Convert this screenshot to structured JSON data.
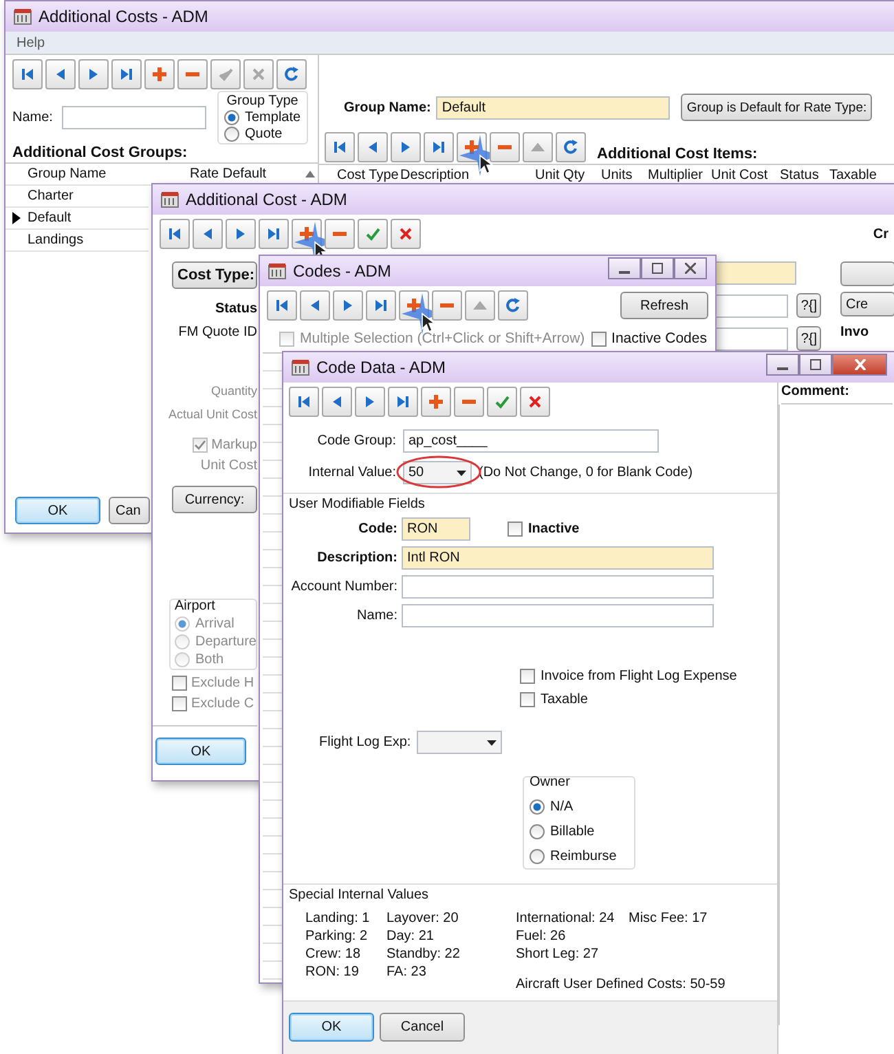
{
  "costs_window": {
    "title": "Additional Costs - ADM",
    "menu": [
      "Help"
    ],
    "toolbar": [
      {
        "kind": "first",
        "disabled": false,
        "clicked": false
      },
      {
        "kind": "prev",
        "disabled": false,
        "clicked": false
      },
      {
        "kind": "next",
        "disabled": false,
        "clicked": false
      },
      {
        "kind": "last",
        "disabled": false,
        "clicked": false
      },
      {
        "kind": "add",
        "disabled": false,
        "clicked": false
      },
      {
        "kind": "remove",
        "disabled": false,
        "clicked": false
      },
      {
        "kind": "save",
        "disabled": true,
        "clicked": false
      },
      {
        "kind": "cancel",
        "disabled": true,
        "clicked": false
      },
      {
        "kind": "refresh",
        "disabled": false,
        "clicked": false
      }
    ],
    "name_label": "Name:",
    "group_type": {
      "label": "Group Type",
      "options": [
        {
          "label": "Template",
          "selected": true
        },
        {
          "label": "Quote",
          "selected": false
        }
      ]
    },
    "groups_title": "Additional Cost Groups:",
    "groups_table": {
      "columns": [
        "Group Name",
        "Rate Default"
      ],
      "rows": [
        {
          "name": "Charter",
          "selected": false
        },
        {
          "name": "Default",
          "selected": true
        },
        {
          "name": "Landings",
          "selected": false
        }
      ]
    },
    "group_name_label": "Group Name:",
    "group_name_value": "Default",
    "rate_type_button": "Group is Default for Rate Type:",
    "items_toolbar": [
      {
        "kind": "first",
        "disabled": false,
        "clicked": false
      },
      {
        "kind": "prev",
        "disabled": false,
        "clicked": false
      },
      {
        "kind": "next",
        "disabled": false,
        "clicked": false
      },
      {
        "kind": "last",
        "disabled": false,
        "clicked": false
      },
      {
        "kind": "add",
        "disabled": false,
        "clicked": true
      },
      {
        "kind": "remove",
        "disabled": false,
        "clicked": false
      },
      {
        "kind": "up",
        "disabled": true,
        "clicked": false
      },
      {
        "kind": "refresh",
        "disabled": false,
        "clicked": false
      }
    ],
    "items_title": "Additional Cost Items:",
    "items_table": {
      "columns": [
        "Cost Type",
        "Description",
        "Unit Qty",
        "Units",
        "Multiplier",
        "Unit Cost",
        "Status",
        "Taxable"
      ]
    },
    "buttons": [
      {
        "label": "OK",
        "default": true
      },
      {
        "label": "Can",
        "default": false
      }
    ]
  },
  "cost_window": {
    "title": "Additional Cost - ADM",
    "toolbar": [
      {
        "kind": "first",
        "disabled": false,
        "clicked": false
      },
      {
        "kind": "prev",
        "disabled": false,
        "clicked": false
      },
      {
        "kind": "next",
        "disabled": false,
        "clicked": false
      },
      {
        "kind": "last",
        "disabled": false,
        "clicked": false
      },
      {
        "kind": "add",
        "disabled": false,
        "clicked": true
      },
      {
        "kind": "remove",
        "disabled": false,
        "clicked": false
      },
      {
        "kind": "save",
        "disabled": false,
        "clicked": false
      },
      {
        "kind": "cancel",
        "disabled": false,
        "clicked": false
      }
    ],
    "corner_label": "Cr",
    "cost_type_button": "Cost Type:",
    "labels_top": [
      {
        "text": "Status",
        "disabled": false
      },
      {
        "text": "FM Quote ID",
        "disabled": false
      }
    ],
    "labels_mid": [
      {
        "text": "Quantity",
        "disabled": true
      },
      {
        "text": "Actual Unit Cost",
        "disabled": true
      }
    ],
    "markup": {
      "label": "Markup",
      "checked": true,
      "disabled": true
    },
    "unit_cost_label": {
      "text": "Unit Cost",
      "disabled": true
    },
    "currency_button": "Currency:",
    "airport": {
      "label": "Airport",
      "disabled": true,
      "options": [
        {
          "label": "Arrival",
          "selected": true
        },
        {
          "label": "Departure",
          "selected": false
        },
        {
          "label": "Both",
          "selected": false
        }
      ]
    },
    "excludes": [
      {
        "label": "Exclude H",
        "checked": false
      },
      {
        "label": "Exclude C",
        "checked": false
      }
    ],
    "ok_button": "OK",
    "lookup_buttons": [
      "?{]",
      "?{]"
    ],
    "side_button": "Cre",
    "side_label": "Invo"
  },
  "codes_window": {
    "title": "Codes - ADM",
    "toolbar": [
      {
        "kind": "first",
        "disabled": false,
        "clicked": false
      },
      {
        "kind": "prev",
        "disabled": false,
        "clicked": false
      },
      {
        "kind": "next",
        "disabled": false,
        "clicked": false
      },
      {
        "kind": "last",
        "disabled": false,
        "clicked": false
      },
      {
        "kind": "add",
        "disabled": false,
        "clicked": true
      },
      {
        "kind": "remove",
        "disabled": false,
        "clicked": false
      },
      {
        "kind": "up",
        "disabled": true,
        "clicked": false
      },
      {
        "kind": "refresh",
        "disabled": false,
        "clicked": false
      }
    ],
    "refresh_button": "Refresh",
    "multi_select": {
      "label": "Multiple Selection (Ctrl+Click or Shift+Arrow)",
      "checked": false,
      "disabled": true
    },
    "inactive_codes": {
      "label": "Inactive Codes",
      "checked": false
    }
  },
  "code_data_window": {
    "title": "Code Data - ADM",
    "toolbar": [
      {
        "kind": "first",
        "disabled": false,
        "clicked": false
      },
      {
        "kind": "prev",
        "disabled": false,
        "clicked": false
      },
      {
        "kind": "next",
        "disabled": false,
        "clicked": false
      },
      {
        "kind": "last",
        "disabled": false,
        "clicked": false
      },
      {
        "kind": "add",
        "disabled": false,
        "clicked": false
      },
      {
        "kind": "remove",
        "disabled": false,
        "clicked": false
      },
      {
        "kind": "save",
        "disabled": false,
        "clicked": false
      },
      {
        "kind": "cancel",
        "disabled": false,
        "clicked": false
      }
    ],
    "code_group": {
      "label": "Code Group:",
      "value": "ap_cost____"
    },
    "internal_value": {
      "label": "Internal Value:",
      "value": "50",
      "annotated": true
    },
    "internal_hint": "(Do Not Change, 0 for Blank Code)",
    "fields_group": "User Modifiable Fields",
    "code": {
      "label": "Code:",
      "value": "RON"
    },
    "inactive": {
      "label": "Inactive",
      "checked": false
    },
    "description": {
      "label": "Description:",
      "value": "Intl RON"
    },
    "account_label": "Account Number:",
    "name_label": "Name:",
    "checks": [
      {
        "label": "Invoice from Flight Log Expense",
        "checked": false
      },
      {
        "label": "Taxable",
        "checked": false
      }
    ],
    "flight_log_label": "Flight Log Exp:",
    "owner": {
      "label": "Owner",
      "options": [
        {
          "label": "N/A",
          "selected": true
        },
        {
          "label": "Billable",
          "selected": false
        },
        {
          "label": "Reimburse",
          "selected": false
        }
      ]
    },
    "special": {
      "title": "Special Internal Values",
      "columns": [
        [
          "Landing: 1",
          "Parking: 2",
          "Crew: 18",
          "RON: 19"
        ],
        [
          "Layover: 20",
          "Day: 21",
          "Standby: 22",
          "FA: 23"
        ],
        [
          "International: 24",
          "Fuel: 26",
          "Short Leg: 27"
        ],
        [
          "Misc Fee: 17"
        ]
      ],
      "footer": "Aircraft User Defined Costs: 50-59"
    },
    "comment_label": "Comment:",
    "buttons": [
      {
        "label": "OK",
        "default": true
      },
      {
        "label": "Cancel",
        "default": false
      }
    ]
  }
}
